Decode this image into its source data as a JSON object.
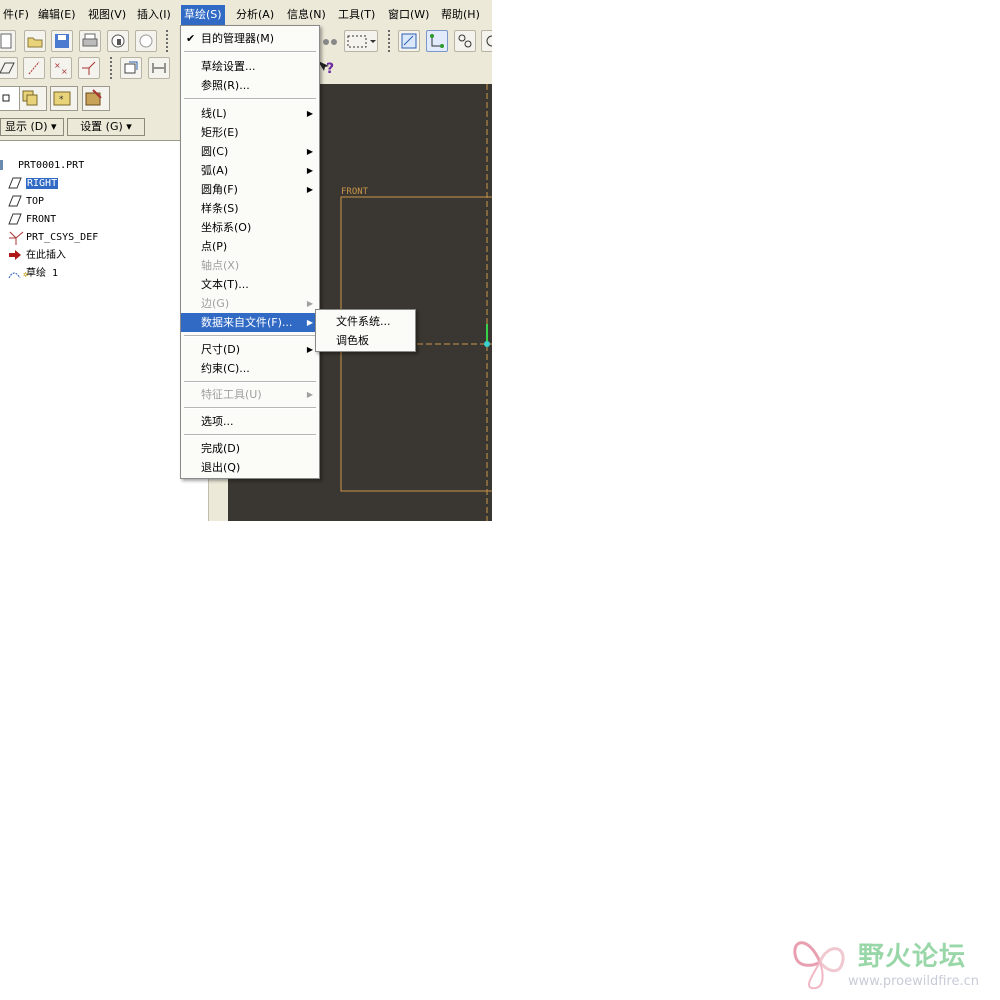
{
  "menubar": {
    "items": [
      "件(F)",
      "编辑(E)",
      "视图(V)",
      "插入(I)",
      "草绘(S)",
      "分析(A)",
      "信息(N)",
      "工具(T)",
      "窗口(W)",
      "帮助(H)"
    ],
    "active_index": 4
  },
  "model_tree": {
    "display_button": "显示 (D) ▾",
    "settings_button": "设置 (G) ▾",
    "items": [
      {
        "label": "PRT0001.PRT",
        "icon": "part-icon"
      },
      {
        "label": "RIGHT",
        "icon": "datum-plane-icon",
        "selected": true
      },
      {
        "label": "TOP",
        "icon": "datum-plane-icon"
      },
      {
        "label": "FRONT",
        "icon": "datum-plane-icon"
      },
      {
        "label": "PRT_CSYS_DEF",
        "icon": "coordinate-system-icon"
      },
      {
        "label": "在此插入",
        "icon": "insert-here-arrow-icon"
      },
      {
        "label": "草绘 1",
        "icon": "sketch-icon"
      }
    ]
  },
  "canvas": {
    "datum_label": "FRONT",
    "background_color": "#3a3631",
    "datum_color": "#c8954a"
  },
  "sketch_menu": {
    "items": [
      {
        "label": "目的管理器(M)",
        "checked": true
      },
      {
        "label": "草绘设置..."
      },
      {
        "label": "参照(R)..."
      },
      {
        "label": "线(L)",
        "submenu": true
      },
      {
        "label": "矩形(E)"
      },
      {
        "label": "圆(C)",
        "submenu": true
      },
      {
        "label": "弧(A)",
        "submenu": true
      },
      {
        "label": "圆角(F)",
        "submenu": true
      },
      {
        "label": "样条(S)"
      },
      {
        "label": "坐标系(O)"
      },
      {
        "label": "点(P)"
      },
      {
        "label": "轴点(X)",
        "disabled": true
      },
      {
        "label": "文本(T)..."
      },
      {
        "label": "边(G)",
        "disabled": true,
        "submenu": true
      },
      {
        "label": "数据来自文件(F)...",
        "submenu": true,
        "highlighted": true
      },
      {
        "label": "尺寸(D)",
        "submenu": true
      },
      {
        "label": "约束(C)..."
      },
      {
        "label": "特征工具(U)",
        "disabled": true,
        "submenu": true
      },
      {
        "label": "选项..."
      },
      {
        "label": "完成(D)"
      },
      {
        "label": "退出(Q)"
      }
    ]
  },
  "data_from_file_submenu": {
    "items": [
      "文件系统...",
      "调色板"
    ]
  },
  "watermark": {
    "title": "野火论坛",
    "url": "www.proewildfire.cn"
  },
  "colors": {
    "menu_highlight": "#316ac5",
    "toolbar_bg": "#ece9d8"
  }
}
